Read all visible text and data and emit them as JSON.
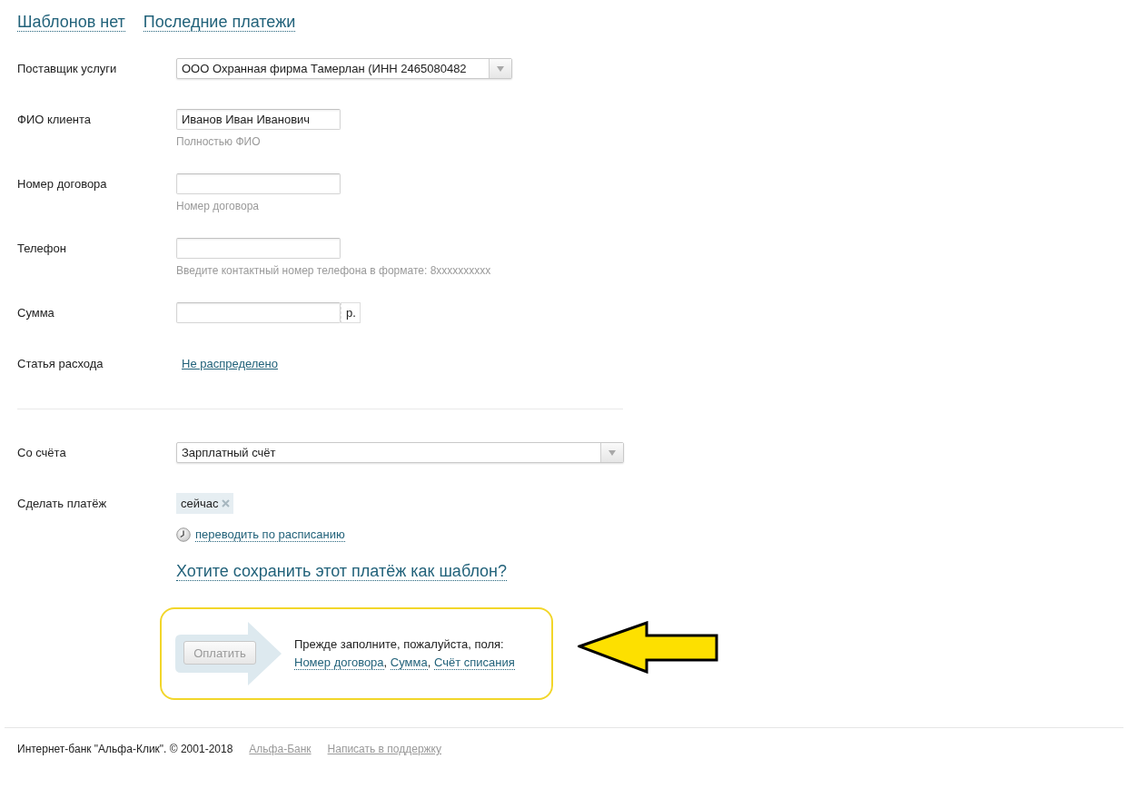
{
  "top_links": [
    {
      "label": "Шаблонов нет"
    },
    {
      "label": "Последние платежи"
    }
  ],
  "payment_fields": [
    {
      "kind": "select",
      "label": "Поставщик услуги",
      "value": "ООО Охранная фирма Тамерлан (ИНН 2465080482"
    },
    {
      "kind": "text",
      "label": "ФИО клиента",
      "value": "Иванов Иван Иванович",
      "hint": "Полностью ФИО"
    },
    {
      "kind": "text",
      "label": "Номер договора",
      "hint": "Номер договора"
    },
    {
      "kind": "text",
      "label": "Телефон",
      "hint": "Введите контактный номер телефона в формате: 8xxxxxxxxxx"
    },
    {
      "kind": "amount",
      "label": "Сумма",
      "unit": "р."
    },
    {
      "kind": "link",
      "label": "Статья расхода",
      "value": "Не распределено"
    }
  ],
  "account_fields": [
    {
      "kind": "select",
      "label": "Со счёта",
      "value": "Зарплатный счёт"
    },
    {
      "kind": "timing",
      "label": "Сделать платёж",
      "chip": "сейчас",
      "schedule_link": "переводить по расписанию"
    }
  ],
  "save_template_link": "Хотите сохранить этот платёж как шаблон?",
  "pay_panel": {
    "button": {
      "label": "Оплатить",
      "disabled": true
    },
    "message": "Прежде заполните, пожалуйста, поля:",
    "missing_fields": [
      {
        "label": "Номер договора",
        "separator": ","
      },
      {
        "label": "Сумма",
        "separator": ","
      },
      {
        "label": "Счёт списания"
      }
    ]
  },
  "footer": {
    "copyright": "Интернет-банк \"Альфа-Клик\". © 2001-2018",
    "links": [
      "Альфа-Банк",
      "Написать в поддержку"
    ]
  }
}
